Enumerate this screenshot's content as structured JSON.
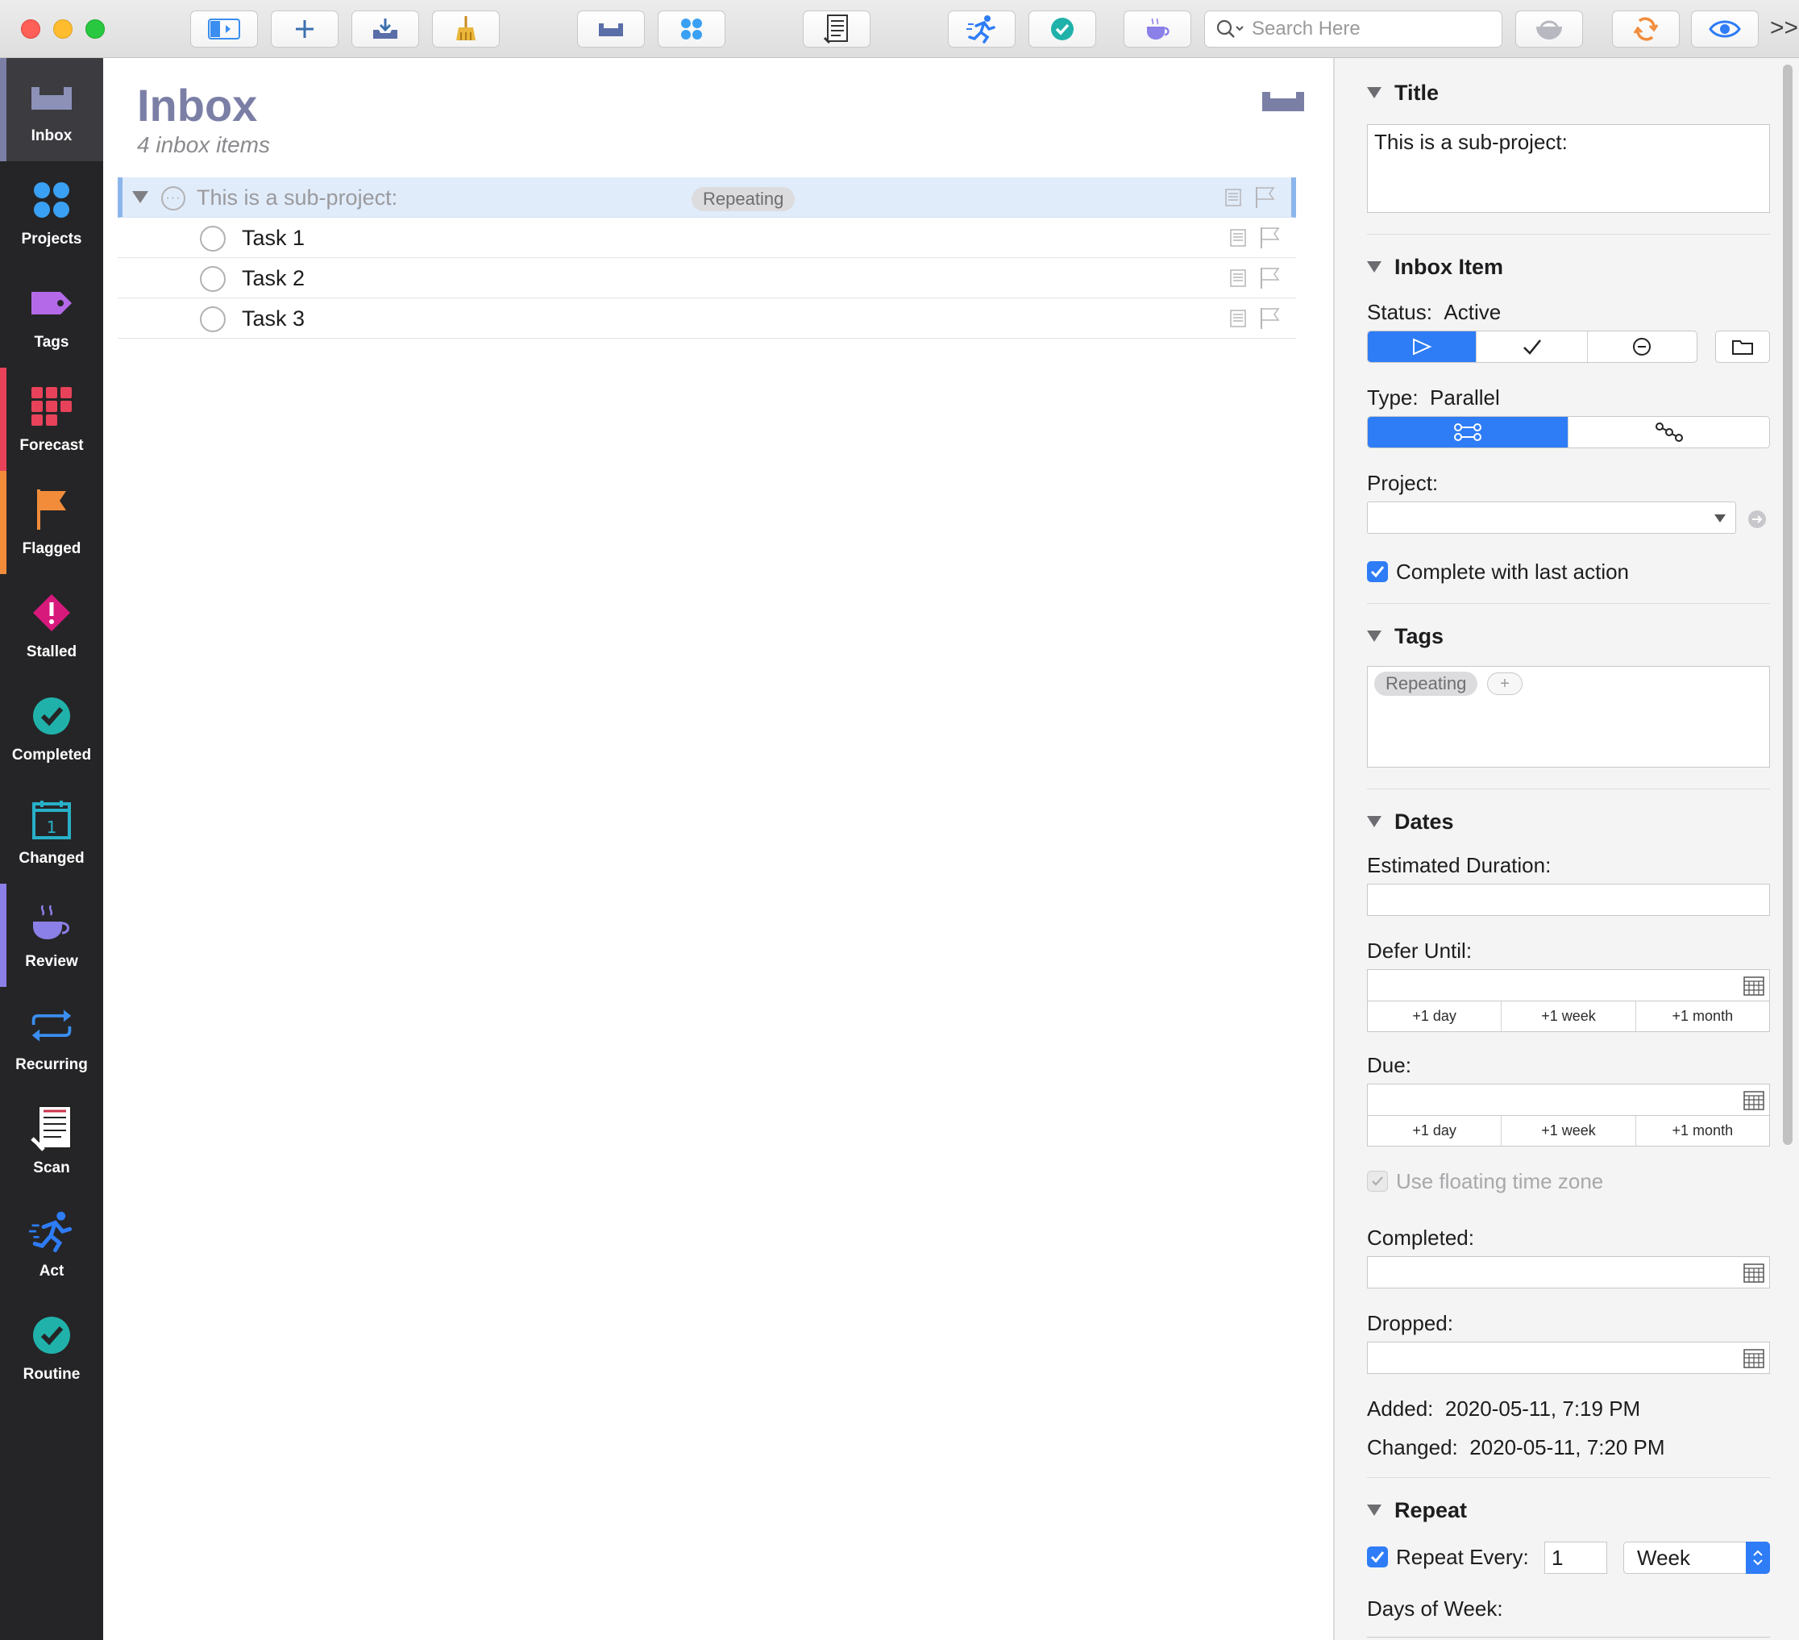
{
  "toolbar": {
    "search_placeholder": "Search Here",
    "overflow_label": ">>"
  },
  "sidebar": {
    "items": [
      {
        "label": "Inbox",
        "icon": "inbox-tray-icon",
        "color": "#7b7fa6"
      },
      {
        "label": "Projects",
        "icon": "projects-dots-icon",
        "color": "#3aa0f3"
      },
      {
        "label": "Tags",
        "icon": "tag-icon",
        "color": "#b46ae8"
      },
      {
        "label": "Forecast",
        "icon": "forecast-grid-icon",
        "color": "#e8425a"
      },
      {
        "label": "Flagged",
        "icon": "flag-icon",
        "color": "#f28c3b"
      },
      {
        "label": "Stalled",
        "icon": "stalled-diamond-icon",
        "color": "#d8197c"
      },
      {
        "label": "Completed",
        "icon": "completed-check-icon",
        "color": "#20b2aa"
      },
      {
        "label": "Changed",
        "icon": "calendar-icon",
        "color": "#28b0c8"
      },
      {
        "label": "Review",
        "icon": "coffee-cup-icon",
        "color": "#8b7fe8"
      },
      {
        "label": "Recurring",
        "icon": "recurring-arrows-icon",
        "color": "#3a8ef0"
      },
      {
        "label": "Scan",
        "icon": "scan-checklist-icon",
        "color": "#444444"
      },
      {
        "label": "Act",
        "icon": "runner-icon",
        "color": "#2e7cf6"
      },
      {
        "label": "Routine",
        "icon": "routine-check-icon",
        "color": "#20b2aa"
      }
    ]
  },
  "main": {
    "title": "Inbox",
    "subtitle": "4 inbox items",
    "project_row": {
      "title": "This is a sub-project:",
      "tag": "Repeating"
    },
    "tasks": [
      {
        "title": "Task 1"
      },
      {
        "title": "Task 2"
      },
      {
        "title": "Task 3"
      }
    ]
  },
  "inspector": {
    "title_section": {
      "heading": "Title",
      "value": "This is a sub-project:"
    },
    "inbox_item": {
      "heading": "Inbox Item",
      "status_label": "Status:",
      "status_value": "Active",
      "type_label": "Type:",
      "type_value": "Parallel",
      "project_label": "Project:",
      "project_value": "",
      "complete_with_last": "Complete with last action"
    },
    "tags_section": {
      "heading": "Tags",
      "tag": "Repeating",
      "add": "+"
    },
    "dates": {
      "heading": "Dates",
      "estimated_duration_label": "Estimated Duration:",
      "defer_label": "Defer Until:",
      "due_label": "Due:",
      "quick": [
        "+1 day",
        "+1 week",
        "+1 month"
      ],
      "floating_tz": "Use floating time zone",
      "completed_label": "Completed:",
      "dropped_label": "Dropped:",
      "added_label": "Added:",
      "added_value": "2020-05-11, 7:19 PM",
      "changed_label": "Changed:",
      "changed_value": "2020-05-11, 7:20 PM"
    },
    "repeat": {
      "heading": "Repeat",
      "repeat_every_label": "Repeat Every:",
      "repeat_count": "1",
      "repeat_unit": "Week",
      "days_of_week_label": "Days of Week:"
    }
  }
}
